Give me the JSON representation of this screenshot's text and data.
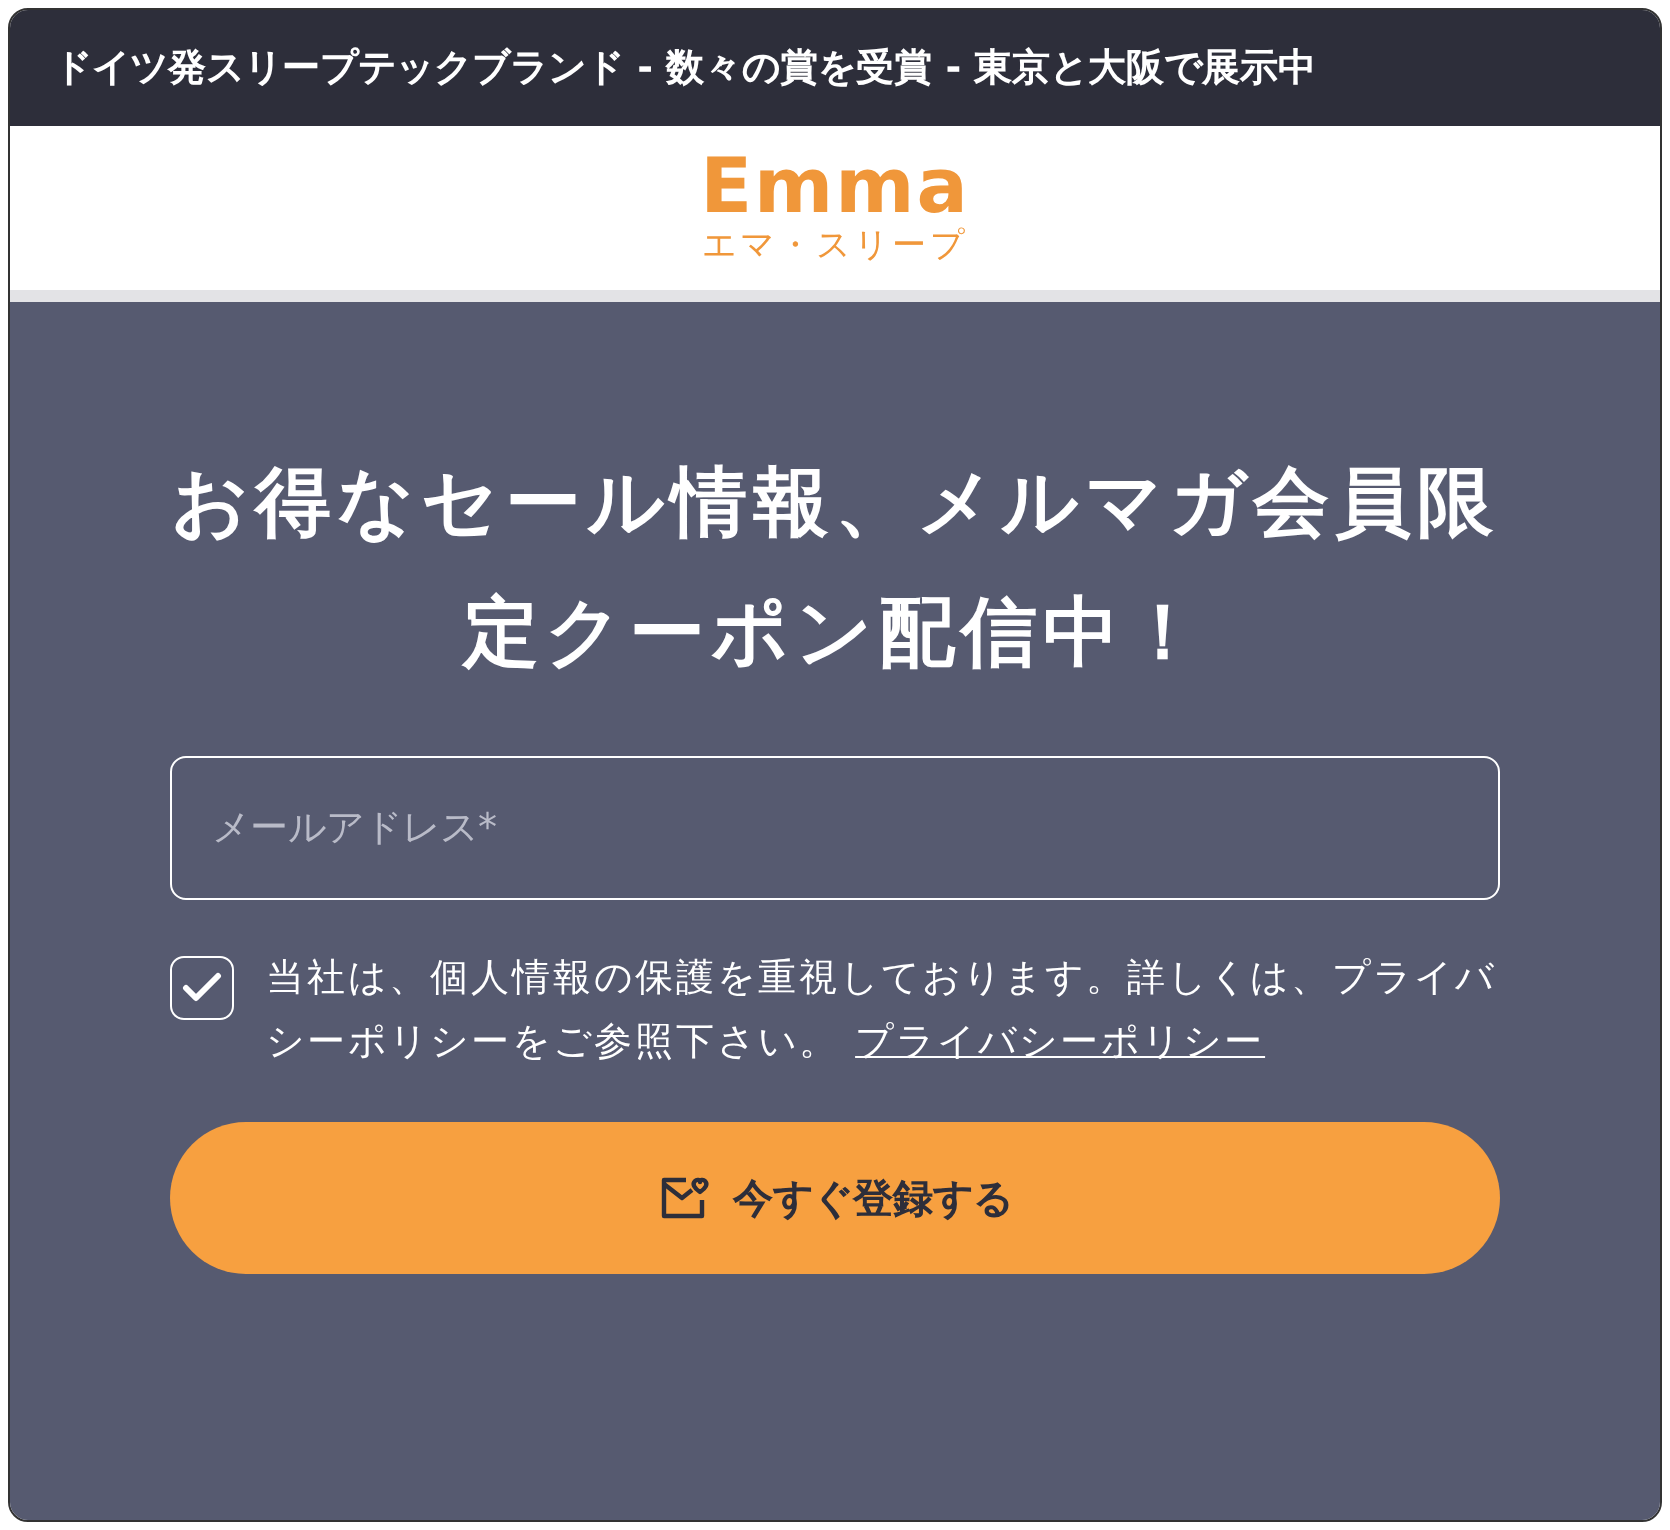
{
  "announcement": "ドイツ発スリープテックブランド - 数々の賞を受賞 - 東京と大阪で展示中",
  "logo": {
    "wordmark": "Emma",
    "subtitle": "エマ・スリープ"
  },
  "headline": "お得なセール情報、メルマガ会員限定クーポン配信中！",
  "email": {
    "placeholder": "メールアドレス*"
  },
  "consent": {
    "checked": true,
    "text": "当社は、個人情報の保護を重視しております。詳しくは、プライバシーポリシーをご参照下さい。",
    "link": "プライバシーポリシー"
  },
  "submit": {
    "label": "今すぐ登録する"
  }
}
